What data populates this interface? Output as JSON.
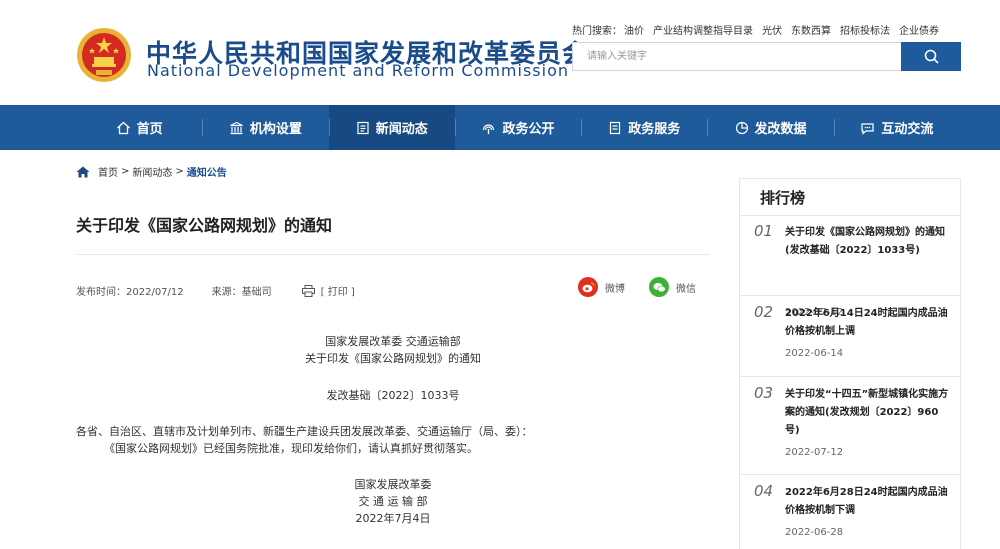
{
  "header": {
    "title_cn": "中华人民共和国国家发展和改革委员会",
    "title_en": "National Development and Reform Commission",
    "hot_label": "热门搜索：",
    "hot_terms": [
      "油价",
      "产业结构调整指导目录",
      "光伏",
      "东数西算",
      "招标投标法",
      "企业债券"
    ],
    "search_placeholder": "请输入关键字",
    "search_icon": "search-icon"
  },
  "nav": {
    "items": [
      {
        "label": "首页",
        "icon": "home-icon"
      },
      {
        "label": "机构设置",
        "icon": "building-icon"
      },
      {
        "label": "新闻动态",
        "icon": "news-icon"
      },
      {
        "label": "政务公开",
        "icon": "broadcast-icon"
      },
      {
        "label": "政务服务",
        "icon": "document-icon"
      },
      {
        "label": "发改数据",
        "icon": "pie-chart-icon"
      },
      {
        "label": "互动交流",
        "icon": "chat-icon"
      }
    ],
    "active_index": 2
  },
  "breadcrumb": {
    "items": [
      "首页",
      "新闻动态",
      "通知公告"
    ],
    "separator": ">"
  },
  "article": {
    "title": "关于印发《国家公路网规划》的通知",
    "publish_time": "发布时间：2022/07/12",
    "source": "来源：基础司",
    "print_label": "[ 打印 ]",
    "share_weibo": "微博",
    "share_wechat": "微信",
    "issuer": "国家发展改革委 交通运输部",
    "doc_title": "关于印发《国家公路网规划》的通知",
    "doc_number": "发改基础〔2022〕1033号",
    "recipients": "各省、自治区、直辖市及计划单列市、新疆生产建设兵团发展改革委、交通运输厅（局、委）：",
    "content": "《国家公路网规划》已经国务院批准，现印发给你们，请认真抓好贯彻落实。",
    "sign_1": "国家发展改革委",
    "sign_2": "交 通 运 输 部",
    "sign_date": "2022年7月4日"
  },
  "ranking": {
    "title": "排行榜",
    "items": [
      {
        "num": "01",
        "text": "关于印发《国家公路网规划》的通知(发改基础〔2022〕1033号)",
        "date": "2022-07-12"
      },
      {
        "num": "02",
        "text": "2022年6月14日24时起国内成品油价格按机制上调",
        "date": "2022-06-14"
      },
      {
        "num": "03",
        "text": "关于印发“十四五”新型城镇化实施方案的通知(发改规划〔2022〕960号)",
        "date": "2022-07-12"
      },
      {
        "num": "04",
        "text": "2022年6月28日24时起国内成品油价格按机制下调",
        "date": "2022-06-28"
      }
    ]
  },
  "colors": {
    "brand_blue": "#1f5b9b",
    "nav_active": "#174a82",
    "weibo_red": "#e0301e",
    "wechat_green": "#3eb135"
  }
}
